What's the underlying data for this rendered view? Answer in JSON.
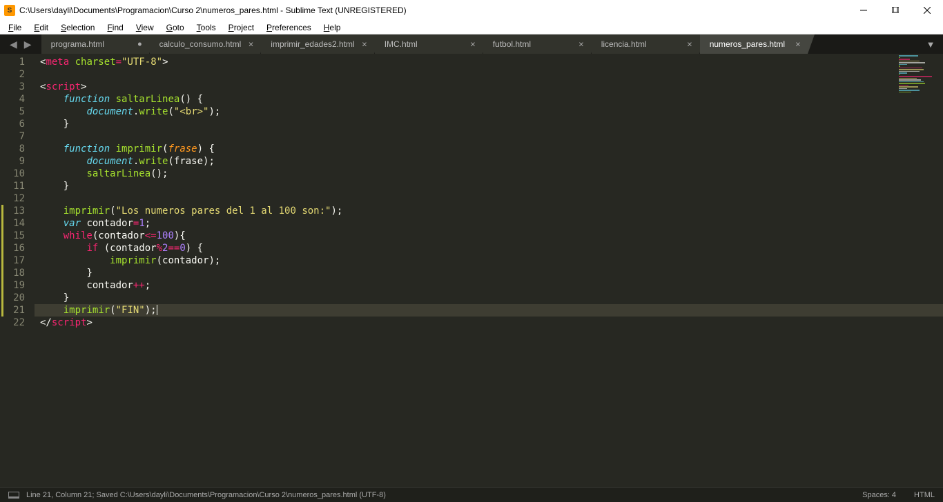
{
  "title": "C:\\Users\\dayli\\Documents\\Programacion\\Curso 2\\numeros_pares.html - Sublime Text (UNREGISTERED)",
  "menu": [
    "File",
    "Edit",
    "Selection",
    "Find",
    "View",
    "Goto",
    "Tools",
    "Project",
    "Preferences",
    "Help"
  ],
  "tabs": [
    {
      "label": "programa.html",
      "dirty": true,
      "active": false
    },
    {
      "label": "calculo_consumo.html",
      "dirty": false,
      "active": false
    },
    {
      "label": "imprimir_edades2.html",
      "dirty": false,
      "active": false
    },
    {
      "label": "IMC.html",
      "dirty": false,
      "active": false
    },
    {
      "label": "futbol.html",
      "dirty": false,
      "active": false
    },
    {
      "label": "licencia.html",
      "dirty": false,
      "active": false
    },
    {
      "label": "numeros_pares.html",
      "dirty": false,
      "active": true
    }
  ],
  "gutter": {
    "total": 22,
    "modified": [
      13,
      14,
      15,
      16,
      17,
      18,
      19,
      20,
      21
    ],
    "active": 21
  },
  "code": {
    "lines": [
      {
        "seg": [
          {
            "c": "pun",
            "t": "<"
          },
          {
            "c": "tag",
            "t": "meta"
          },
          {
            "c": "va",
            "t": " "
          },
          {
            "c": "attr",
            "t": "charset"
          },
          {
            "c": "op",
            "t": "="
          },
          {
            "c": "str",
            "t": "\"UTF-8\""
          },
          {
            "c": "pun",
            "t": ">"
          }
        ]
      },
      {
        "seg": []
      },
      {
        "seg": [
          {
            "c": "pun",
            "t": "<"
          },
          {
            "c": "tag",
            "t": "script"
          },
          {
            "c": "pun",
            "t": ">"
          }
        ]
      },
      {
        "seg": [
          {
            "c": "va",
            "t": "    "
          },
          {
            "c": "st",
            "t": "function"
          },
          {
            "c": "va",
            "t": " "
          },
          {
            "c": "fn",
            "t": "saltarLinea"
          },
          {
            "c": "pun",
            "t": "() {"
          }
        ]
      },
      {
        "seg": [
          {
            "c": "va",
            "t": "        "
          },
          {
            "c": "st",
            "t": "document"
          },
          {
            "c": "pun",
            "t": "."
          },
          {
            "c": "fn",
            "t": "write"
          },
          {
            "c": "pun",
            "t": "("
          },
          {
            "c": "str",
            "t": "\"<br>\""
          },
          {
            "c": "pun",
            "t": ");"
          }
        ]
      },
      {
        "seg": [
          {
            "c": "va",
            "t": "    "
          },
          {
            "c": "pun",
            "t": "}"
          }
        ]
      },
      {
        "seg": []
      },
      {
        "seg": [
          {
            "c": "va",
            "t": "    "
          },
          {
            "c": "st",
            "t": "function"
          },
          {
            "c": "va",
            "t": " "
          },
          {
            "c": "fn",
            "t": "imprimir"
          },
          {
            "c": "pun",
            "t": "("
          },
          {
            "c": "prm",
            "t": "frase"
          },
          {
            "c": "pun",
            "t": ") {"
          }
        ]
      },
      {
        "seg": [
          {
            "c": "va",
            "t": "        "
          },
          {
            "c": "st",
            "t": "document"
          },
          {
            "c": "pun",
            "t": "."
          },
          {
            "c": "fn",
            "t": "write"
          },
          {
            "c": "pun",
            "t": "(frase);"
          }
        ]
      },
      {
        "seg": [
          {
            "c": "va",
            "t": "        "
          },
          {
            "c": "fn",
            "t": "saltarLinea"
          },
          {
            "c": "pun",
            "t": "();"
          }
        ]
      },
      {
        "seg": [
          {
            "c": "va",
            "t": "    "
          },
          {
            "c": "pun",
            "t": "}"
          }
        ]
      },
      {
        "seg": []
      },
      {
        "seg": [
          {
            "c": "va",
            "t": "    "
          },
          {
            "c": "fn",
            "t": "imprimir"
          },
          {
            "c": "pun",
            "t": "("
          },
          {
            "c": "str",
            "t": "\"Los numeros pares del 1 al 100 son:\""
          },
          {
            "c": "pun",
            "t": ");"
          }
        ]
      },
      {
        "seg": [
          {
            "c": "va",
            "t": "    "
          },
          {
            "c": "st",
            "t": "var"
          },
          {
            "c": "va",
            "t": " contador"
          },
          {
            "c": "op",
            "t": "="
          },
          {
            "c": "num",
            "t": "1"
          },
          {
            "c": "pun",
            "t": ";"
          }
        ]
      },
      {
        "seg": [
          {
            "c": "va",
            "t": "    "
          },
          {
            "c": "kw",
            "t": "while"
          },
          {
            "c": "pun",
            "t": "(contador"
          },
          {
            "c": "op",
            "t": "<="
          },
          {
            "c": "num",
            "t": "100"
          },
          {
            "c": "pun",
            "t": "){"
          }
        ]
      },
      {
        "seg": [
          {
            "c": "va",
            "t": "        "
          },
          {
            "c": "kw",
            "t": "if"
          },
          {
            "c": "pun",
            "t": " (contador"
          },
          {
            "c": "op",
            "t": "%"
          },
          {
            "c": "num",
            "t": "2"
          },
          {
            "c": "op",
            "t": "=="
          },
          {
            "c": "num",
            "t": "0"
          },
          {
            "c": "pun",
            "t": ") {"
          }
        ]
      },
      {
        "seg": [
          {
            "c": "va",
            "t": "            "
          },
          {
            "c": "fn",
            "t": "imprimir"
          },
          {
            "c": "pun",
            "t": "(contador);"
          }
        ]
      },
      {
        "seg": [
          {
            "c": "va",
            "t": "        "
          },
          {
            "c": "pun",
            "t": "}"
          }
        ]
      },
      {
        "seg": [
          {
            "c": "va",
            "t": "        contador"
          },
          {
            "c": "op",
            "t": "++"
          },
          {
            "c": "pun",
            "t": ";"
          }
        ]
      },
      {
        "seg": [
          {
            "c": "va",
            "t": "    "
          },
          {
            "c": "pun",
            "t": "}"
          }
        ]
      },
      {
        "seg": [
          {
            "c": "va",
            "t": "    "
          },
          {
            "c": "fn",
            "t": "imprimir"
          },
          {
            "c": "pun",
            "t": "("
          },
          {
            "c": "str",
            "t": "\"FIN\""
          },
          {
            "c": "pun",
            "t": ");"
          }
        ],
        "cursor": true
      },
      {
        "seg": [
          {
            "c": "pun",
            "t": "</"
          },
          {
            "c": "tag",
            "t": "script"
          },
          {
            "c": "pun",
            "t": ">"
          }
        ]
      }
    ]
  },
  "status": {
    "left": "Line 21, Column 21; Saved C:\\Users\\dayli\\Documents\\Programacion\\Curso 2\\numeros_pares.html (UTF-8)",
    "spaces": "Spaces: 4",
    "lang": "HTML"
  },
  "minimap_widths": [
    28,
    2,
    16,
    30,
    38,
    12,
    2,
    34,
    36,
    30,
    12,
    2,
    48,
    26,
    32,
    36,
    38,
    14,
    28,
    12,
    30,
    18
  ]
}
